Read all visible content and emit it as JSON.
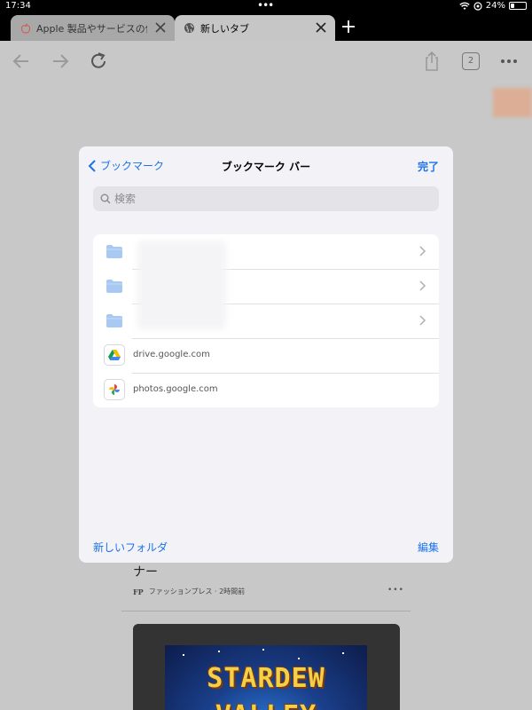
{
  "status_bar": {
    "time": "17:34",
    "battery": "24%",
    "battery_level": 0.24,
    "icons": [
      "wifi-icon",
      "location-icon",
      "battery-icon"
    ]
  },
  "tabs": [
    {
      "label": "Apple 製品やサービスの使…",
      "icon": "apple-icon",
      "active": false
    },
    {
      "label": "新しいタブ",
      "icon": "globe-icon",
      "active": true
    }
  ],
  "toolbar": {
    "tab_count": "2",
    "icons": [
      "back-arrow-icon",
      "forward-arrow-icon",
      "reload-icon",
      "share-icon",
      "more-icon"
    ]
  },
  "modal": {
    "back_label": "ブックマーク",
    "title": "ブックマーク バー",
    "done_label": "完了",
    "search_placeholder": "検索",
    "bookmarks": [
      {
        "type": "folder"
      },
      {
        "type": "folder"
      },
      {
        "type": "folder"
      },
      {
        "type": "site",
        "label": "drive.google.com",
        "icon": "google-drive-icon"
      },
      {
        "type": "site",
        "label": "photos.google.com",
        "icon": "google-photos-icon"
      }
    ],
    "new_folder_label": "新しいフォルダ",
    "edit_label": "編集"
  },
  "background": {
    "article_title_fragment": "ナー",
    "source_logo": "FP",
    "source_meta": "ファッションプレス · 2時間前",
    "more_label": "•••",
    "game_title_line1": "STARDEW",
    "game_title_line2": "VALLEY"
  },
  "colors": {
    "accent": "#1a73e8",
    "modal_bg": "#f2f2f7",
    "folder": "#a9c8f2",
    "dim_bg": "#c8c8c8"
  }
}
